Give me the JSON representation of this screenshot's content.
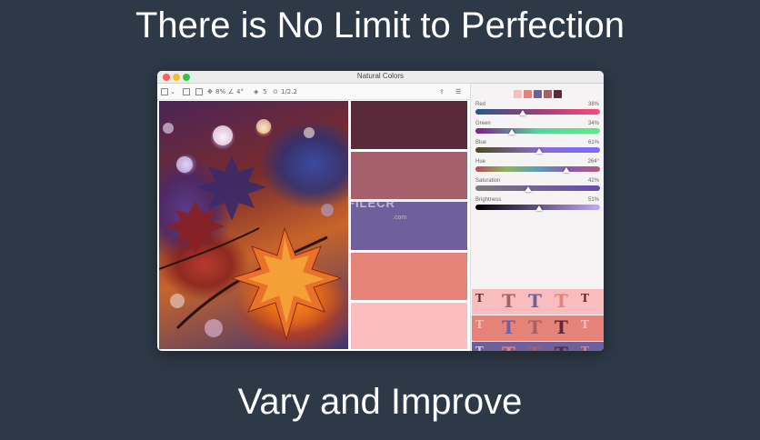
{
  "headline_top": "There is No Limit to Perfection",
  "headline_bottom": "Vary and Improve",
  "window": {
    "title": "Natural Colors",
    "toolbar": {
      "zoom": "8%",
      "angle": "4°",
      "count": "5",
      "ratio": "1/2.2"
    }
  },
  "palette": [
    {
      "name": "plum",
      "color": "#5a2a3a"
    },
    {
      "name": "mauve",
      "color": "#a5606b"
    },
    {
      "name": "violet",
      "color": "#6f5f9b"
    },
    {
      "name": "coral",
      "color": "#e58378"
    },
    {
      "name": "pink",
      "color": "#fbbcbd"
    }
  ],
  "mini_palette": [
    "#fbbcbd",
    "#e58378",
    "#6f5f9b",
    "#a5606b",
    "#5a2a3a"
  ],
  "sliders": [
    {
      "label": "Red",
      "value": "38%",
      "level": 0.38,
      "gradient": "linear-gradient(90deg,#1e5b8c,#a03c78,#ff4a7a)"
    },
    {
      "label": "Green",
      "value": "34%",
      "level": 0.29,
      "gradient": "linear-gradient(90deg,#7a1e8a,#5ad1a0,#5eea8c)"
    },
    {
      "label": "Blue",
      "value": "61%",
      "level": 0.51,
      "gradient": "linear-gradient(90deg,#4a4a1a,#8a6cc8,#7a6cff)"
    },
    {
      "label": "Hue",
      "value": "264°",
      "level": 0.73,
      "gradient": "linear-gradient(90deg,#b64a5a,#8ab45a,#5aa0b4,#8a5ab4,#b45a7a)"
    },
    {
      "label": "Saturation",
      "value": "42%",
      "level": 0.42,
      "gradient": "linear-gradient(90deg,#7a7a7a,#6a4ab4)"
    },
    {
      "label": "Brightness",
      "value": "51%",
      "level": 0.51,
      "gradient": "linear-gradient(90deg,#000000,#c6a6ff)"
    }
  ],
  "watermark": "FILECR",
  "watermark_sub": ".com"
}
